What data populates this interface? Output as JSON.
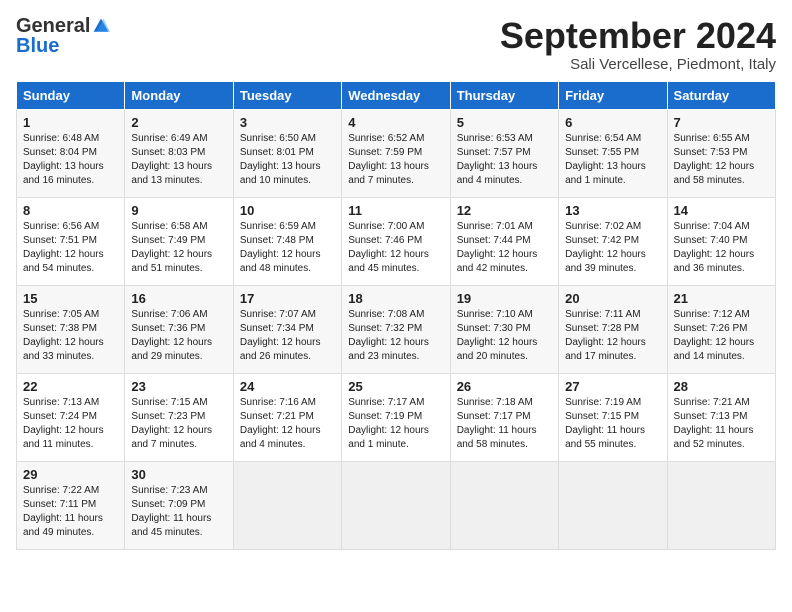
{
  "header": {
    "logo_general": "General",
    "logo_blue": "Blue",
    "title": "September 2024",
    "location": "Sali Vercellese, Piedmont, Italy"
  },
  "weekdays": [
    "Sunday",
    "Monday",
    "Tuesday",
    "Wednesday",
    "Thursday",
    "Friday",
    "Saturday"
  ],
  "weeks": [
    [
      {
        "day": "1",
        "info": "Sunrise: 6:48 AM\nSunset: 8:04 PM\nDaylight: 13 hours\nand 16 minutes."
      },
      {
        "day": "2",
        "info": "Sunrise: 6:49 AM\nSunset: 8:03 PM\nDaylight: 13 hours\nand 13 minutes."
      },
      {
        "day": "3",
        "info": "Sunrise: 6:50 AM\nSunset: 8:01 PM\nDaylight: 13 hours\nand 10 minutes."
      },
      {
        "day": "4",
        "info": "Sunrise: 6:52 AM\nSunset: 7:59 PM\nDaylight: 13 hours\nand 7 minutes."
      },
      {
        "day": "5",
        "info": "Sunrise: 6:53 AM\nSunset: 7:57 PM\nDaylight: 13 hours\nand 4 minutes."
      },
      {
        "day": "6",
        "info": "Sunrise: 6:54 AM\nSunset: 7:55 PM\nDaylight: 13 hours\nand 1 minute."
      },
      {
        "day": "7",
        "info": "Sunrise: 6:55 AM\nSunset: 7:53 PM\nDaylight: 12 hours\nand 58 minutes."
      }
    ],
    [
      {
        "day": "8",
        "info": "Sunrise: 6:56 AM\nSunset: 7:51 PM\nDaylight: 12 hours\nand 54 minutes."
      },
      {
        "day": "9",
        "info": "Sunrise: 6:58 AM\nSunset: 7:49 PM\nDaylight: 12 hours\nand 51 minutes."
      },
      {
        "day": "10",
        "info": "Sunrise: 6:59 AM\nSunset: 7:48 PM\nDaylight: 12 hours\nand 48 minutes."
      },
      {
        "day": "11",
        "info": "Sunrise: 7:00 AM\nSunset: 7:46 PM\nDaylight: 12 hours\nand 45 minutes."
      },
      {
        "day": "12",
        "info": "Sunrise: 7:01 AM\nSunset: 7:44 PM\nDaylight: 12 hours\nand 42 minutes."
      },
      {
        "day": "13",
        "info": "Sunrise: 7:02 AM\nSunset: 7:42 PM\nDaylight: 12 hours\nand 39 minutes."
      },
      {
        "day": "14",
        "info": "Sunrise: 7:04 AM\nSunset: 7:40 PM\nDaylight: 12 hours\nand 36 minutes."
      }
    ],
    [
      {
        "day": "15",
        "info": "Sunrise: 7:05 AM\nSunset: 7:38 PM\nDaylight: 12 hours\nand 33 minutes."
      },
      {
        "day": "16",
        "info": "Sunrise: 7:06 AM\nSunset: 7:36 PM\nDaylight: 12 hours\nand 29 minutes."
      },
      {
        "day": "17",
        "info": "Sunrise: 7:07 AM\nSunset: 7:34 PM\nDaylight: 12 hours\nand 26 minutes."
      },
      {
        "day": "18",
        "info": "Sunrise: 7:08 AM\nSunset: 7:32 PM\nDaylight: 12 hours\nand 23 minutes."
      },
      {
        "day": "19",
        "info": "Sunrise: 7:10 AM\nSunset: 7:30 PM\nDaylight: 12 hours\nand 20 minutes."
      },
      {
        "day": "20",
        "info": "Sunrise: 7:11 AM\nSunset: 7:28 PM\nDaylight: 12 hours\nand 17 minutes."
      },
      {
        "day": "21",
        "info": "Sunrise: 7:12 AM\nSunset: 7:26 PM\nDaylight: 12 hours\nand 14 minutes."
      }
    ],
    [
      {
        "day": "22",
        "info": "Sunrise: 7:13 AM\nSunset: 7:24 PM\nDaylight: 12 hours\nand 11 minutes."
      },
      {
        "day": "23",
        "info": "Sunrise: 7:15 AM\nSunset: 7:23 PM\nDaylight: 12 hours\nand 7 minutes."
      },
      {
        "day": "24",
        "info": "Sunrise: 7:16 AM\nSunset: 7:21 PM\nDaylight: 12 hours\nand 4 minutes."
      },
      {
        "day": "25",
        "info": "Sunrise: 7:17 AM\nSunset: 7:19 PM\nDaylight: 12 hours\nand 1 minute."
      },
      {
        "day": "26",
        "info": "Sunrise: 7:18 AM\nSunset: 7:17 PM\nDaylight: 11 hours\nand 58 minutes."
      },
      {
        "day": "27",
        "info": "Sunrise: 7:19 AM\nSunset: 7:15 PM\nDaylight: 11 hours\nand 55 minutes."
      },
      {
        "day": "28",
        "info": "Sunrise: 7:21 AM\nSunset: 7:13 PM\nDaylight: 11 hours\nand 52 minutes."
      }
    ],
    [
      {
        "day": "29",
        "info": "Sunrise: 7:22 AM\nSunset: 7:11 PM\nDaylight: 11 hours\nand 49 minutes."
      },
      {
        "day": "30",
        "info": "Sunrise: 7:23 AM\nSunset: 7:09 PM\nDaylight: 11 hours\nand 45 minutes."
      },
      null,
      null,
      null,
      null,
      null
    ]
  ]
}
